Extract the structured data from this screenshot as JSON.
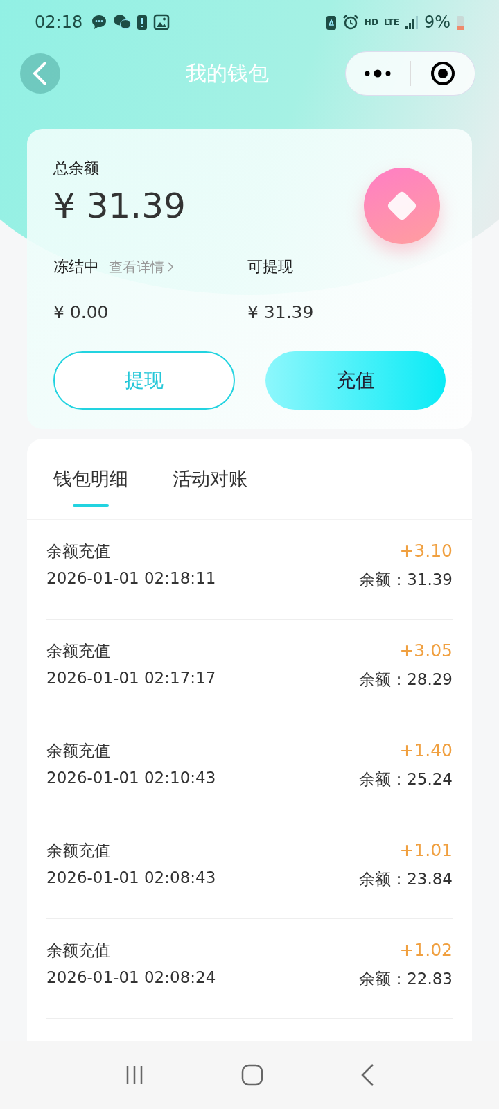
{
  "status_bar": {
    "time": "02:18",
    "hd": "HD",
    "network": "LTE",
    "battery": "9%"
  },
  "header": {
    "title": "我的钱包"
  },
  "wallet": {
    "total_label": "总余额",
    "total_amount": "¥ 31.39",
    "frozen_label": "冻结中",
    "details_link": "查看详情",
    "frozen_amount": "¥ 0.00",
    "withdrawable_label": "可提现",
    "withdrawable_amount": "¥ 31.39",
    "buttons": [
      {
        "label": "提现",
        "kind": "outline"
      },
      {
        "label": "充值",
        "kind": "filled"
      }
    ]
  },
  "tabs": [
    {
      "label": "钱包明细",
      "selected": true
    },
    {
      "label": "活动对账",
      "selected": false
    }
  ],
  "transactions": [
    {
      "title": "余额充值",
      "time": "2026-01-01 02:18:11",
      "amount": "+3.10",
      "balance": "余额：31.39"
    },
    {
      "title": "余额充值",
      "time": "2026-01-01 02:17:17",
      "amount": "+3.05",
      "balance": "余额：28.29"
    },
    {
      "title": "余额充值",
      "time": "2026-01-01 02:10:43",
      "amount": "+1.40",
      "balance": "余额：25.24"
    },
    {
      "title": "余额充值",
      "time": "2026-01-01 02:08:43",
      "amount": "+1.01",
      "balance": "余额：23.84"
    },
    {
      "title": "余额充值",
      "time": "2026-01-01 02:08:24",
      "amount": "+1.02",
      "balance": "余额：22.83"
    }
  ]
}
